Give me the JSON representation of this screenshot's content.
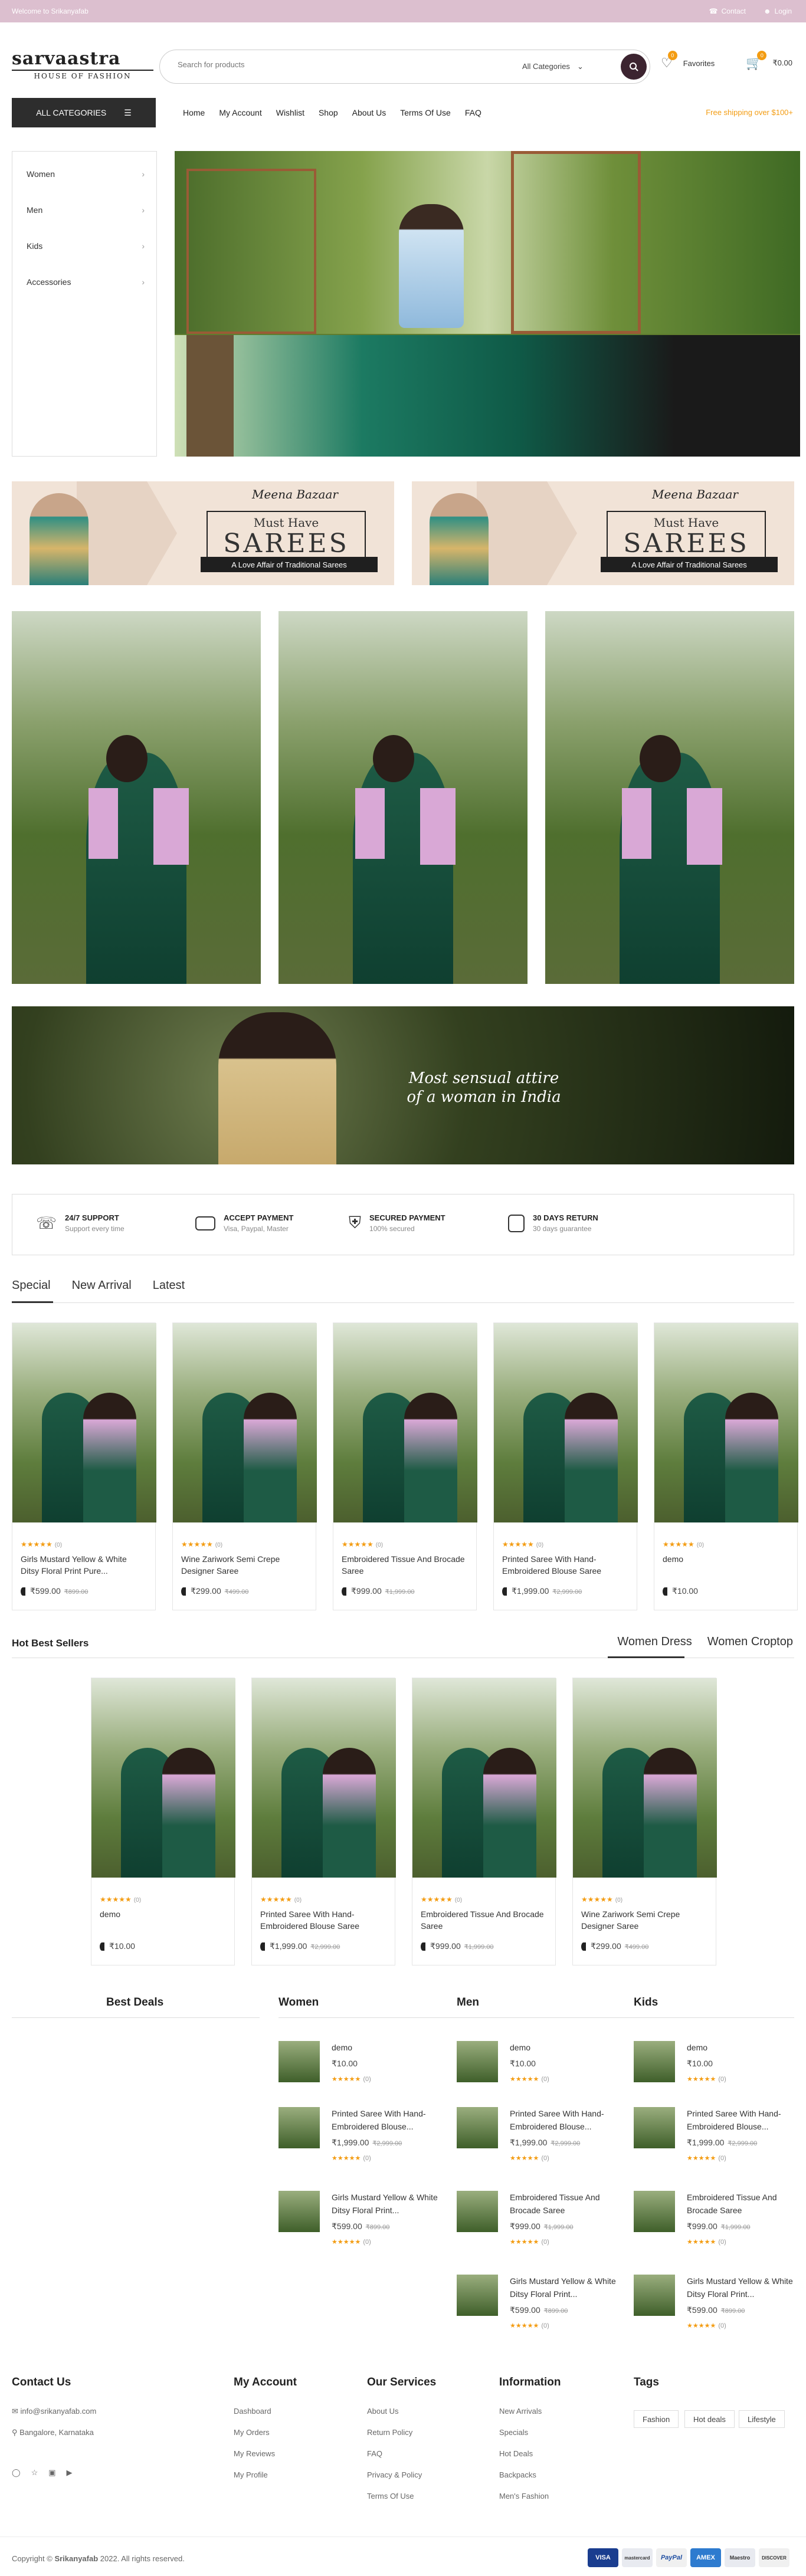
{
  "topbar": {
    "welcome": "Welcome to Srikanyafab",
    "contact": "Contact",
    "login": "Login"
  },
  "header": {
    "logo_title": "sarvaastra",
    "logo_sub": "HOUSE OF FASHION",
    "search_placeholder": "Search for products",
    "category_select": "All Categories",
    "favorites_label": "Favorites",
    "favorites_count": "0",
    "cart_total": "₹0.00",
    "cart_count": "0"
  },
  "nav": {
    "all_categories": "ALL CATEGORIES",
    "menu": [
      "Home",
      "My Account",
      "Wishlist",
      "Shop",
      "About Us",
      "Terms Of Use",
      "FAQ"
    ],
    "free_shipping": "Free shipping over $100+"
  },
  "sidebar": {
    "items": [
      "Women",
      "Men",
      "Kids",
      "Accessories"
    ]
  },
  "promo": {
    "brand": "Meena Bazaar",
    "heading": "Must Have",
    "big": "SAREES",
    "tagline": "A Love Affair of Traditional Sarees"
  },
  "wide_banner": {
    "line1": "Most sensual attire",
    "line2": "of a woman in India"
  },
  "features": [
    {
      "title": "24/7 SUPPORT",
      "sub": "Support every time",
      "icon": "headset-icon"
    },
    {
      "title": "ACCEPT PAYMENT",
      "sub": "Visa, Paypal, Master",
      "icon": "card-icon"
    },
    {
      "title": "SECURED PAYMENT",
      "sub": "100% secured",
      "icon": "shield-icon"
    },
    {
      "title": "30 DAYS RETURN",
      "sub": "30 days guarantee",
      "icon": "calendar-icon"
    }
  ],
  "tabs": [
    "Special",
    "New Arrival",
    "Latest"
  ],
  "products": [
    {
      "name": "Girls Mustard Yellow & White Ditsy Floral Print Pure...",
      "price": "₹599.00",
      "old": "₹899.00",
      "reviews": "(0)"
    },
    {
      "name": "Wine Zariwork Semi Crepe Designer Saree",
      "price": "₹299.00",
      "old": "₹499.00",
      "reviews": "(0)"
    },
    {
      "name": "Embroidered Tissue And Brocade Saree",
      "price": "₹999.00",
      "old": "₹1,999.00",
      "reviews": "(0)"
    },
    {
      "name": "Printed Saree With Hand-Embroidered Blouse Saree",
      "price": "₹1,999.00",
      "old": "₹2,999.00",
      "reviews": "(0)"
    },
    {
      "name": "demo",
      "price": "₹10.00",
      "old": "",
      "reviews": "(0)"
    }
  ],
  "hot": {
    "title": "Hot Best Sellers",
    "tabs": [
      "Women Dress",
      "Women Croptop"
    ],
    "products": [
      {
        "name": "demo",
        "price": "₹10.00",
        "old": "",
        "reviews": "(0)"
      },
      {
        "name": "Printed Saree With Hand-Embroidered Blouse Saree",
        "price": "₹1,999.00",
        "old": "₹2,999.00",
        "reviews": "(0)"
      },
      {
        "name": "Embroidered Tissue And Brocade Saree",
        "price": "₹999.00",
        "old": "₹1,999.00",
        "reviews": "(0)"
      },
      {
        "name": "Wine Zariwork Semi Crepe Designer Saree",
        "price": "₹299.00",
        "old": "₹499.00",
        "reviews": "(0)"
      }
    ]
  },
  "deals": {
    "best_deals": "Best Deals",
    "women_title": "Women",
    "men_title": "Men",
    "kids_title": "Kids",
    "women": [
      {
        "name": "demo",
        "price": "₹10.00",
        "old": "",
        "reviews": "(0)"
      },
      {
        "name": "Printed Saree With Hand-Embroidered Blouse...",
        "price": "₹1,999.00",
        "old": "₹2,999.00",
        "reviews": "(0)"
      },
      {
        "name": "Girls Mustard Yellow & White Ditsy Floral Print...",
        "price": "₹599.00",
        "old": "₹899.00",
        "reviews": "(0)"
      }
    ],
    "men": [
      {
        "name": "demo",
        "price": "₹10.00",
        "old": "",
        "reviews": "(0)"
      },
      {
        "name": "Printed Saree With Hand-Embroidered Blouse...",
        "price": "₹1,999.00",
        "old": "₹2,999.00",
        "reviews": "(0)"
      },
      {
        "name": "Embroidered Tissue And Brocade Saree",
        "price": "₹999.00",
        "old": "₹1,999.00",
        "reviews": "(0)"
      },
      {
        "name": "Girls Mustard Yellow & White Ditsy Floral Print...",
        "price": "₹599.00",
        "old": "₹899.00",
        "reviews": "(0)"
      }
    ],
    "kids": [
      {
        "name": "demo",
        "price": "₹10.00",
        "old": "",
        "reviews": "(0)"
      },
      {
        "name": "Printed Saree With Hand-Embroidered Blouse...",
        "price": "₹1,999.00",
        "old": "₹2,999.00",
        "reviews": "(0)"
      },
      {
        "name": "Embroidered Tissue And Brocade Saree",
        "price": "₹999.00",
        "old": "₹1,999.00",
        "reviews": "(0)"
      },
      {
        "name": "Girls Mustard Yellow & White Ditsy Floral Print...",
        "price": "₹599.00",
        "old": "₹899.00",
        "reviews": "(0)"
      }
    ]
  },
  "footer": {
    "contact_title": "Contact Us",
    "email": "info@srikanyafab.com",
    "address": "Bangalore, Karnataka",
    "account_title": "My Account",
    "account": [
      "Dashboard",
      "My Orders",
      "My Reviews",
      "My Profile"
    ],
    "services_title": "Our Services",
    "services": [
      "About Us",
      "Return Policy",
      "FAQ",
      "Privacy & Policy",
      "Terms Of Use"
    ],
    "info_title": "Information",
    "info": [
      "New Arrivals",
      "Specials",
      "Hot Deals",
      "Backpacks",
      "Men's Fashion"
    ],
    "tags_title": "Tags",
    "tags": [
      "Fashion",
      "Hot deals",
      "Lifestyle"
    ],
    "copyright_prefix": "Copyright © ",
    "copyright_brand": "Srikanyafab",
    "copyright_suffix": " 2022. All rights reserved.",
    "payments": [
      "VISA",
      "mastercard",
      "PayPal",
      "AMEX",
      "Maestro",
      "DISCOVER"
    ]
  },
  "colors": {
    "topbar": "#dcbfcf",
    "accent": "#f39c12",
    "search_button": "#3c2430",
    "dark": "#2d2d2d"
  }
}
